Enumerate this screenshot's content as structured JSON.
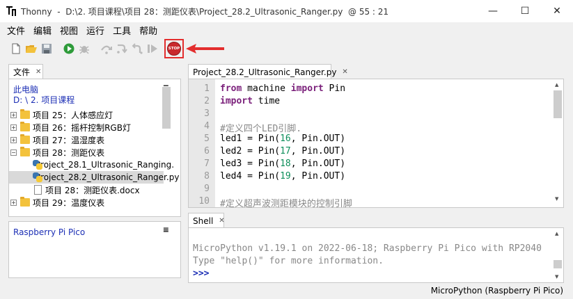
{
  "window": {
    "app_name": "Thonny",
    "title": "D:\\2. 项目课程\\项目 28：测距仪表\\Project_28.2_Ultrasonic_Ranger.py",
    "cursor": "@  55 : 21",
    "minimize": "—",
    "maximize": "☐",
    "close": "✕"
  },
  "menu": [
    "文件",
    "编辑",
    "视图",
    "运行",
    "工具",
    "帮助"
  ],
  "toolbar": {
    "icons": [
      "new-file-icon",
      "open-file-icon",
      "save-icon",
      "run-icon",
      "debug-icon",
      "step-over-icon",
      "step-into-icon",
      "step-out-icon",
      "resume-icon",
      "stop-icon"
    ],
    "stop_label": "STOP",
    "highlight_color": "#e32d2d"
  },
  "files": {
    "tab_label": "文件",
    "location_title": "此电脑",
    "location_path": "D: \\ 2. 项目课程",
    "menu_glyph": "≡",
    "items": [
      {
        "label": "项目 25：人体感应灯",
        "type": "folder",
        "expander": "+"
      },
      {
        "label": "项目 26：摇杆控制RGB灯",
        "type": "folder",
        "expander": "+"
      },
      {
        "label": "项目 27：温湿度表",
        "type": "folder",
        "expander": "+"
      },
      {
        "label": "项目 28：测距仪表",
        "type": "folder",
        "expander": "−"
      },
      {
        "label": "Project_28.1_Ultrasonic_Ranging.",
        "type": "python"
      },
      {
        "label": "Project_28.2_Ultrasonic_Ranger.py",
        "type": "python",
        "selected": true
      },
      {
        "label": "项目 28：测距仪表.docx",
        "type": "doc"
      },
      {
        "label": "项目 29：温度仪表",
        "type": "folder",
        "expander": "+"
      }
    ]
  },
  "device": {
    "title": "Raspberry Pi Pico",
    "menu_glyph": "≡"
  },
  "editor": {
    "tab_label": "Project_28.2_Ultrasonic_Ranger.py",
    "line_numbers": [
      "1",
      "2",
      "3",
      "4",
      "5",
      "6",
      "7",
      "8",
      "9",
      "10"
    ],
    "lines": [
      [
        {
          "t": "from",
          "c": "kw"
        },
        {
          "t": " machine ",
          "c": ""
        },
        {
          "t": "import",
          "c": "kw"
        },
        {
          "t": " Pin",
          "c": ""
        }
      ],
      [
        {
          "t": "import",
          "c": "kw"
        },
        {
          "t": " time",
          "c": ""
        }
      ],
      [],
      [
        {
          "t": "#定义四个LED引脚.",
          "c": "cm"
        }
      ],
      [
        {
          "t": "led1 = Pin(",
          "c": ""
        },
        {
          "t": "16",
          "c": "num"
        },
        {
          "t": ", Pin.OUT)",
          "c": ""
        }
      ],
      [
        {
          "t": "led2 = Pin(",
          "c": ""
        },
        {
          "t": "17",
          "c": "num"
        },
        {
          "t": ", Pin.OUT)",
          "c": ""
        }
      ],
      [
        {
          "t": "led3 = Pin(",
          "c": ""
        },
        {
          "t": "18",
          "c": "num"
        },
        {
          "t": ", Pin.OUT)",
          "c": ""
        }
      ],
      [
        {
          "t": "led4 = Pin(",
          "c": ""
        },
        {
          "t": "19",
          "c": "num"
        },
        {
          "t": ", Pin.OUT)",
          "c": ""
        }
      ],
      [],
      [
        {
          "t": "#定义超声波测距模块的控制引脚",
          "c": "cm"
        }
      ]
    ]
  },
  "shell": {
    "tab_label": "Shell",
    "line1": "MicroPython v1.19.1 on 2022-06-18; Raspberry Pi Pico with RP2040",
    "line2": "Type \"help()\" for more information.",
    "prompt": ">>>"
  },
  "status": {
    "interpreter": "MicroPython (Raspberry Pi Pico)"
  }
}
